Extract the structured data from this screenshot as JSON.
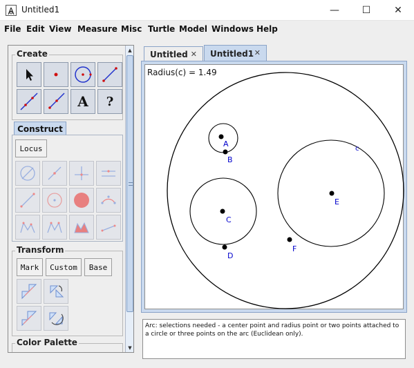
{
  "window": {
    "title": "Untitled1",
    "minimize": "—",
    "maximize": "☐",
    "close": "✕"
  },
  "menu": [
    "File",
    "Edit",
    "View",
    "Measure",
    "Misc",
    "Turtle",
    "Model",
    "Windows",
    "Help"
  ],
  "panel": {
    "create_title": "Create",
    "create_tools": [
      "arrow-tool",
      "point-tool",
      "circle-tool",
      "segment-tool",
      "line-tool",
      "ray-tool",
      "text-tool",
      "help-tool"
    ],
    "text_tool_label": "A",
    "help_tool_label": "?",
    "construct_tab": "Construct",
    "locus_button": "Locus",
    "transform_title": "Transform",
    "mark_button": "Mark",
    "custom_button": "Custom",
    "base_button": "Base",
    "color_palette_title": "Color Palette"
  },
  "tabs": [
    {
      "label": "Untitled",
      "close": "✕"
    },
    {
      "label": "Untitled1",
      "close": "✕"
    }
  ],
  "canvas": {
    "radius_label": "Radius(c) = 1.49",
    "points": [
      "A",
      "B",
      "C",
      "D",
      "E",
      "F"
    ],
    "circle_label": "c",
    "label_color": "#0000cc"
  },
  "status": "Arc: selections needed - a center point and radius point or two points attached to a circle or three points on the arc (Euclidean only)."
}
